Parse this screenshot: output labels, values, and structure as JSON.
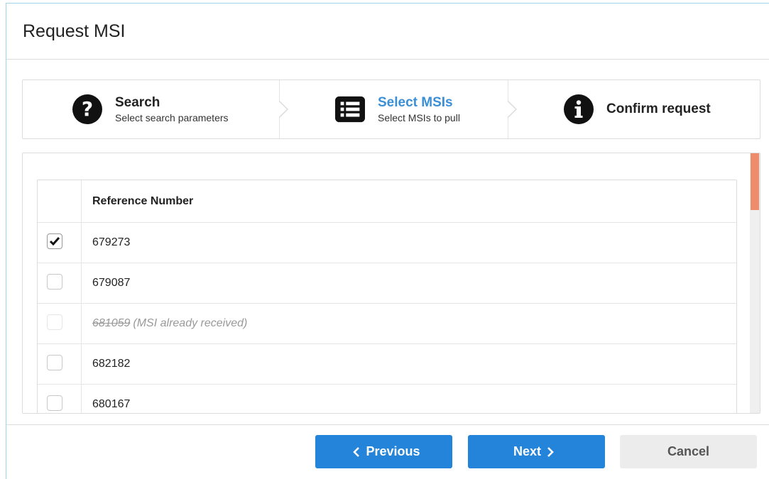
{
  "dialog": {
    "title": "Request MSI"
  },
  "steps": [
    {
      "title": "Search",
      "subtitle": "Select search parameters",
      "icon": "question-circle-icon",
      "active": false
    },
    {
      "title": "Select MSIs",
      "subtitle": "Select MSIs to pull",
      "icon": "list-icon",
      "active": true
    },
    {
      "title": "Confirm request",
      "subtitle": "",
      "icon": "info-circle-icon",
      "active": false
    }
  ],
  "table": {
    "header": "Reference Number",
    "rows": [
      {
        "ref": "679273",
        "checked": true,
        "disabled": false,
        "note": ""
      },
      {
        "ref": "679087",
        "checked": false,
        "disabled": false,
        "note": ""
      },
      {
        "ref": "681059",
        "checked": false,
        "disabled": true,
        "note": "(MSI already received)"
      },
      {
        "ref": "682182",
        "checked": false,
        "disabled": false,
        "note": ""
      },
      {
        "ref": "680167",
        "checked": false,
        "disabled": false,
        "note": ""
      }
    ]
  },
  "buttons": {
    "previous": "Previous",
    "next": "Next",
    "cancel": "Cancel"
  },
  "colors": {
    "accent": "#2384d9",
    "active_step": "#3b8fd6",
    "scroll_thumb": "#ef8c6b"
  }
}
